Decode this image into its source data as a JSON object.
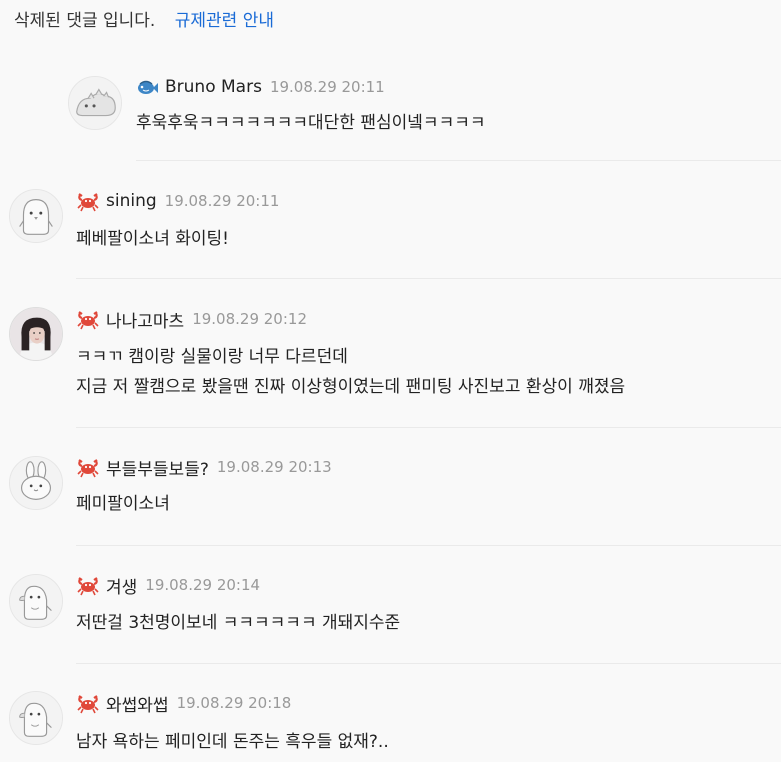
{
  "notice": {
    "text": "삭제된 댓글 입니다.",
    "link": "규제관련 안내"
  },
  "comments": [
    {
      "author": "Bruno Mars",
      "time": "19.08.29 20:11",
      "badge": "fish-icon",
      "avatar": "dino-avatar",
      "lines": [
        "후욱후욱ㅋㅋㅋㅋㅋㅋㅋ대단한 팬심이넼ㅋㅋㅋㅋ"
      ]
    },
    {
      "author": "sining",
      "time": "19.08.29 20:11",
      "badge": "crab-icon",
      "avatar": "penguin-avatar",
      "lines": [
        "페베팔이소녀 화이팅!"
      ]
    },
    {
      "author": "나나고마츠",
      "time": "19.08.29 20:12",
      "badge": "crab-icon",
      "avatar": "photo-avatar",
      "lines": [
        "ㅋㅋㄲ 캠이랑 실물이랑 너무 다르던데",
        "지금 저 짤캠으로 봤을땐 진짜 이상형이였는데 팬미팅 사진보고 환상이 깨졌음"
      ]
    },
    {
      "author": "부들부들보들?",
      "time": "19.08.29 20:13",
      "badge": "crab-icon",
      "avatar": "rabbit-avatar",
      "lines": [
        "페미팔이소녀"
      ]
    },
    {
      "author": "겨생",
      "time": "19.08.29 20:14",
      "badge": "crab-icon",
      "avatar": "penguin-side-avatar",
      "lines": [
        "저딴걸 3천명이보네 ㅋㅋㅋㅋㅋㅋ 개돼지수준"
      ]
    },
    {
      "author": "와썹와썹",
      "time": "19.08.29 20:18",
      "badge": "crab-icon",
      "avatar": "penguin-side-avatar",
      "lines": [
        "남자 욕하는 페미인데 돈주는 흑우들 없재?.."
      ]
    }
  ],
  "colors": {
    "link": "#1a6bd6",
    "crab": "#e0483a",
    "fish": "#3d86c6",
    "meta": "#999999"
  }
}
